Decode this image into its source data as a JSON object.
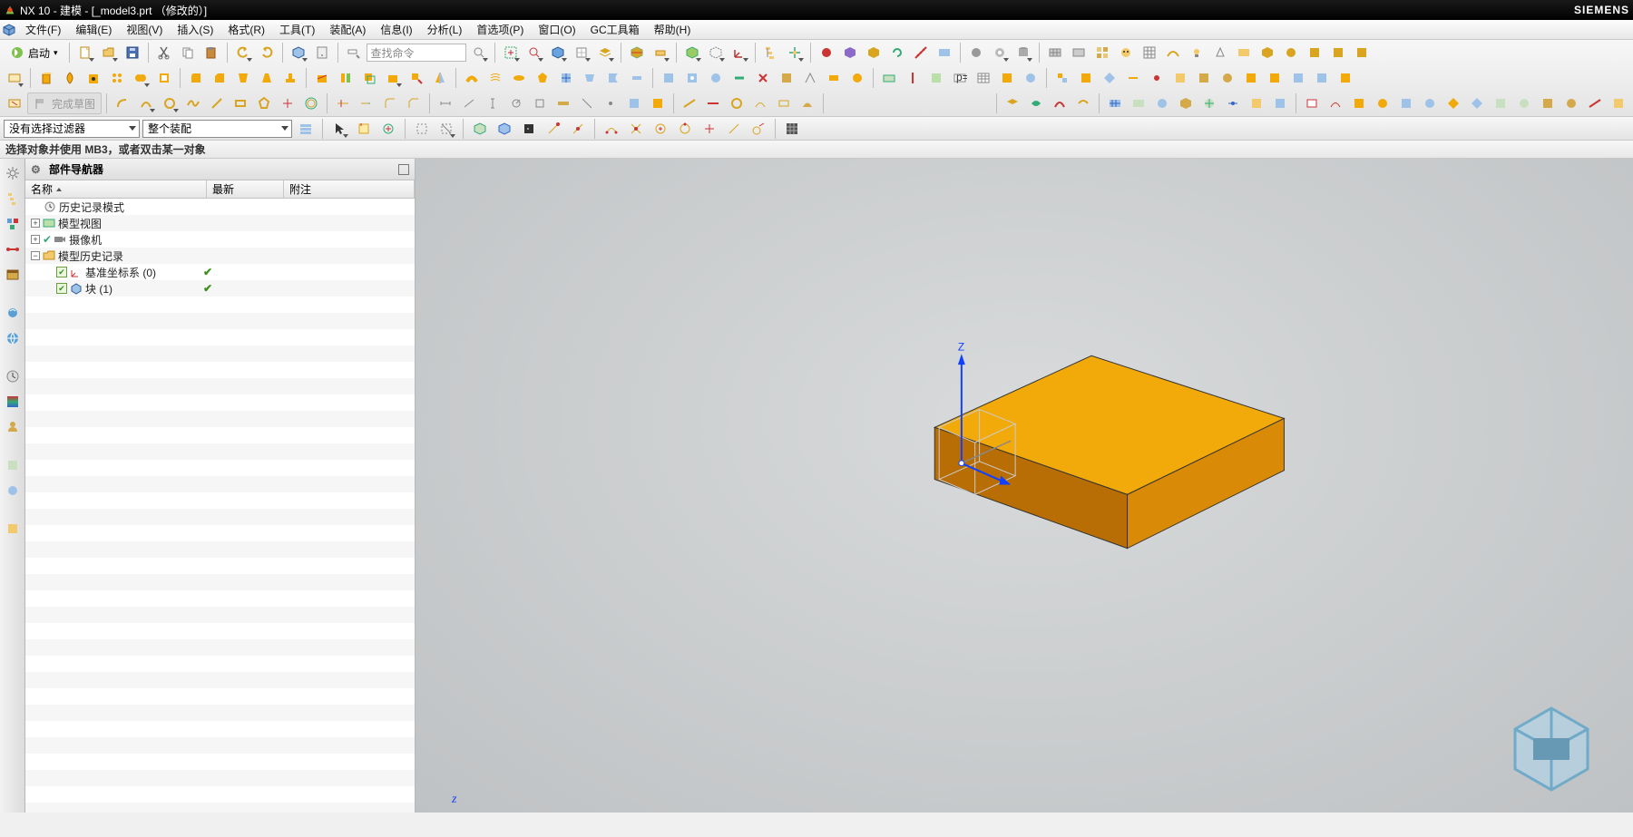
{
  "title": {
    "app": "NX 10",
    "mode": "建模",
    "file": "[_model3.prt （修改的）]",
    "brand": "SIEMENS"
  },
  "menubar": [
    {
      "label": "文件(F)"
    },
    {
      "label": "编辑(E)"
    },
    {
      "label": "视图(V)"
    },
    {
      "label": "插入(S)"
    },
    {
      "label": "格式(R)"
    },
    {
      "label": "工具(T)"
    },
    {
      "label": "装配(A)"
    },
    {
      "label": "信息(I)"
    },
    {
      "label": "分析(L)"
    },
    {
      "label": "首选项(P)"
    },
    {
      "label": "窗口(O)"
    },
    {
      "label": "GC工具箱"
    },
    {
      "label": "帮助(H)"
    }
  ],
  "toolbar": {
    "start_label": "启动",
    "cmd_search_placeholder": "查找命令",
    "finish_sketch": "完成草图"
  },
  "filterbar": {
    "filter_combo": "没有选择过滤器",
    "scope_combo": "整个装配"
  },
  "hint": "选择对象并使用 MB3，或者双击某一对象",
  "navigator": {
    "title": "部件导航器",
    "columns": {
      "name": "名称",
      "new": "最新",
      "note": "附注"
    },
    "tree": {
      "history_mode": "历史记录模式",
      "model_views": "模型视图",
      "cameras": "摄像机",
      "model_history": "模型历史记录",
      "datum_csys": "基准坐标系 (0)",
      "block": "块 (1)"
    }
  },
  "axes": {
    "z": "Z",
    "z_small": "z"
  },
  "colors": {
    "block_top": "#f2a90a",
    "block_front": "#d98a06",
    "block_side": "#b86e04"
  }
}
